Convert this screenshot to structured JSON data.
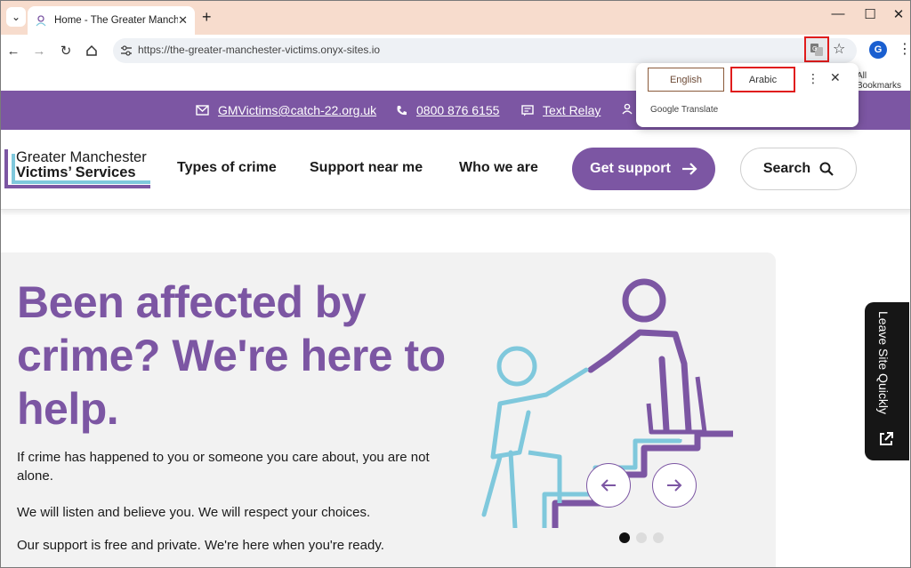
{
  "browser": {
    "tab_title": "Home - The Greater Manchester Victims' Services",
    "url": "https://the-greater-manchester-victims.onyx-sites.io",
    "profile_initial": "G",
    "bookmarks_label": "All Bookmarks"
  },
  "translate_popup": {
    "option_english": "English",
    "option_arabic": "Arabic",
    "brand": "Google Translate"
  },
  "topbar": {
    "email": "GMVictims@catch-22.org.uk",
    "phone": "0800 876 6155",
    "text_relay": "Text Relay"
  },
  "logo": {
    "line1": "Greater Manchester",
    "line2": "Victims’ Services"
  },
  "nav": {
    "items": [
      "Types of crime",
      "Support near me",
      "Who we are"
    ],
    "get_support": "Get support",
    "search": "Search"
  },
  "hero": {
    "title": "Been affected by crime? We're here to help.",
    "paragraphs": [
      "If crime has happened to you or someone you care about, you are not alone.",
      "We will listen and believe you. We will respect your choices.",
      "Our support is free and private. We're here when you're ready."
    ],
    "carousel_active_index": 0,
    "carousel_count": 3
  },
  "leave_site": "Leave Site Quickly",
  "colors": {
    "brand_purple": "#7c56a3",
    "brand_blue": "#7fc8dc",
    "tabbar": "#f7dccd",
    "highlight_red": "#e01c1c"
  }
}
